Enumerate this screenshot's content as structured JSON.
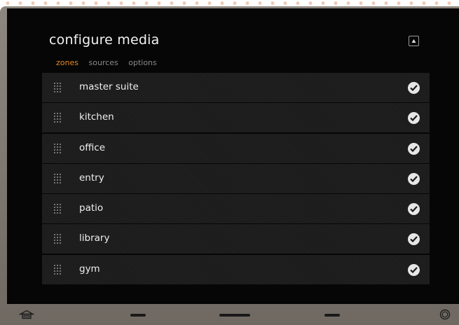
{
  "header": {
    "title": "configure media"
  },
  "tabs": [
    {
      "label": "zones",
      "active": true
    },
    {
      "label": "sources",
      "active": false
    },
    {
      "label": "options",
      "active": false
    }
  ],
  "zones": [
    {
      "label": "master suite",
      "checked": true
    },
    {
      "label": "kitchen",
      "checked": true
    },
    {
      "label": "office",
      "checked": true
    },
    {
      "label": "entry",
      "checked": true
    },
    {
      "label": "patio",
      "checked": true
    },
    {
      "label": "library",
      "checked": true
    },
    {
      "label": "gym",
      "checked": true
    }
  ],
  "icons": {
    "collapse": "triangle-up-icon",
    "check": "check-circle-icon",
    "grip": "drag-handle-icon",
    "home": "home-icon",
    "settings": "settings-icon"
  },
  "colors": {
    "active_tab": "#e8891c",
    "screen_bg": "#060606",
    "row_bg": "#1c1c1c",
    "frame": "#7d7770"
  }
}
